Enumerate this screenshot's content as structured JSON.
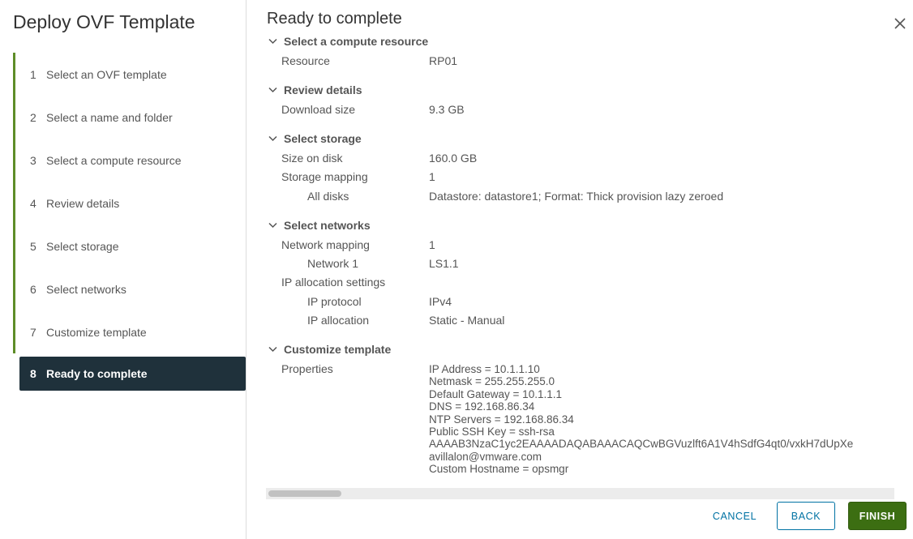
{
  "wizard": {
    "title": "Deploy OVF Template"
  },
  "steps": [
    {
      "num": "1",
      "label": "Select an OVF template"
    },
    {
      "num": "2",
      "label": "Select a name and folder"
    },
    {
      "num": "3",
      "label": "Select a compute resource"
    },
    {
      "num": "4",
      "label": "Review details"
    },
    {
      "num": "5",
      "label": "Select storage"
    },
    {
      "num": "6",
      "label": "Select networks"
    },
    {
      "num": "7",
      "label": "Customize template"
    },
    {
      "num": "8",
      "label": "Ready to complete"
    }
  ],
  "active_step": "8",
  "page": {
    "title": "Ready to complete"
  },
  "sections": {
    "compute": {
      "title": "Select a compute resource",
      "resource_label": "Resource",
      "resource_value": "RP01"
    },
    "review": {
      "title": "Review details",
      "download_label": "Download size",
      "download_value": "9.3 GB"
    },
    "storage": {
      "title": "Select storage",
      "size_label": "Size on disk",
      "size_value": "160.0 GB",
      "mapping_label": "Storage mapping",
      "mapping_value": "1",
      "disks_label": "All disks",
      "disks_value": "Datastore: datastore1; Format: Thick provision lazy zeroed"
    },
    "networks": {
      "title": "Select networks",
      "mapping_label": "Network mapping",
      "mapping_value": "1",
      "network1_label": "Network 1",
      "network1_value": "LS1.1",
      "ip_settings_label": "IP allocation settings",
      "protocol_label": "IP protocol",
      "protocol_value": "IPv4",
      "allocation_label": "IP allocation",
      "allocation_value": "Static - Manual"
    },
    "customize": {
      "title": "Customize template",
      "properties_label": "Properties",
      "properties_lines": [
        "IP Address = 10.1.1.10",
        "Netmask = 255.255.255.0",
        "Default Gateway = 10.1.1.1",
        "DNS = 192.168.86.34",
        "NTP Servers = 192.168.86.34",
        "Public SSH Key = ssh-rsa",
        "AAAAB3NzaC1yc2EAAAADAQABAAACAQCwBGVuzlft6A1V4hSdfG4qt0/vxkH7dUpXe",
        "avillalon@vmware.com",
        "Custom Hostname = opsmgr"
      ]
    }
  },
  "buttons": {
    "cancel": "CANCEL",
    "back": "BACK",
    "finish": "FINISH"
  },
  "colors": {
    "accent_green": "#5e8d28",
    "active_step_bg": "#1f313b",
    "finish_bg": "#3c6e12",
    "link_blue": "#0072a3"
  },
  "icons": {
    "close": "close-icon",
    "chevron": "chevron-down-icon"
  }
}
